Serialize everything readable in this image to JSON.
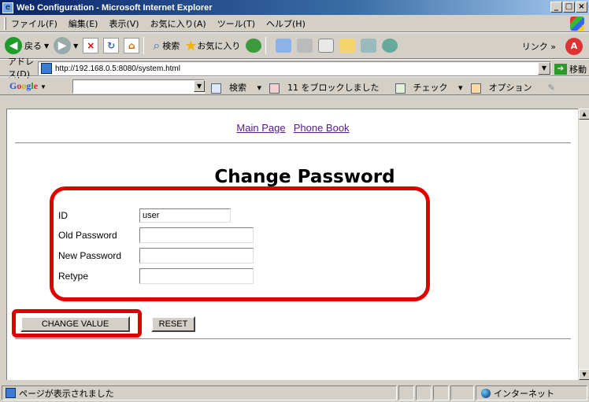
{
  "window": {
    "title": "Web Configuration - Microsoft Internet Explorer",
    "buttons": [
      "_",
      "□",
      "×"
    ]
  },
  "menu": [
    "ファイル(F)",
    "編集(E)",
    "表示(V)",
    "お気に入り(A)",
    "ツール(T)",
    "ヘルプ(H)"
  ],
  "toolbar": {
    "back_label": "戻る",
    "search_label": "検索",
    "favorites_label": "お気に入り",
    "links_label": "リンク",
    "links_chevron": "»"
  },
  "address": {
    "label": "アドレス(D)",
    "url": "http://192.168.0.5:8080/system.html",
    "go_label": "移動"
  },
  "googlebar": {
    "logo": {
      "g": "G",
      "o1": "o",
      "o2": "o",
      "g2": "g",
      "l": "l",
      "e": "e"
    },
    "search_label": "検索",
    "blocked_label": "11 をブロックしました",
    "check_label": "チェック",
    "options_label": "オプション"
  },
  "page": {
    "nav_links": [
      "Main Page",
      "Phone Book"
    ],
    "heading": "Change Password",
    "form": {
      "id_label": "ID",
      "id_value": "user",
      "old_label": "Old Password",
      "old_value": "",
      "new_label": "New Password",
      "new_value": "",
      "retype_label": "Retype",
      "retype_value": ""
    },
    "buttons": {
      "change": "CHANGE VALUE",
      "reset": "RESET"
    }
  },
  "status": {
    "text": "ページが表示されました",
    "zone": "インターネット"
  },
  "colors": {
    "highlight": "#e00000",
    "titlebar": "#0a246a",
    "link": "#551a8b"
  }
}
